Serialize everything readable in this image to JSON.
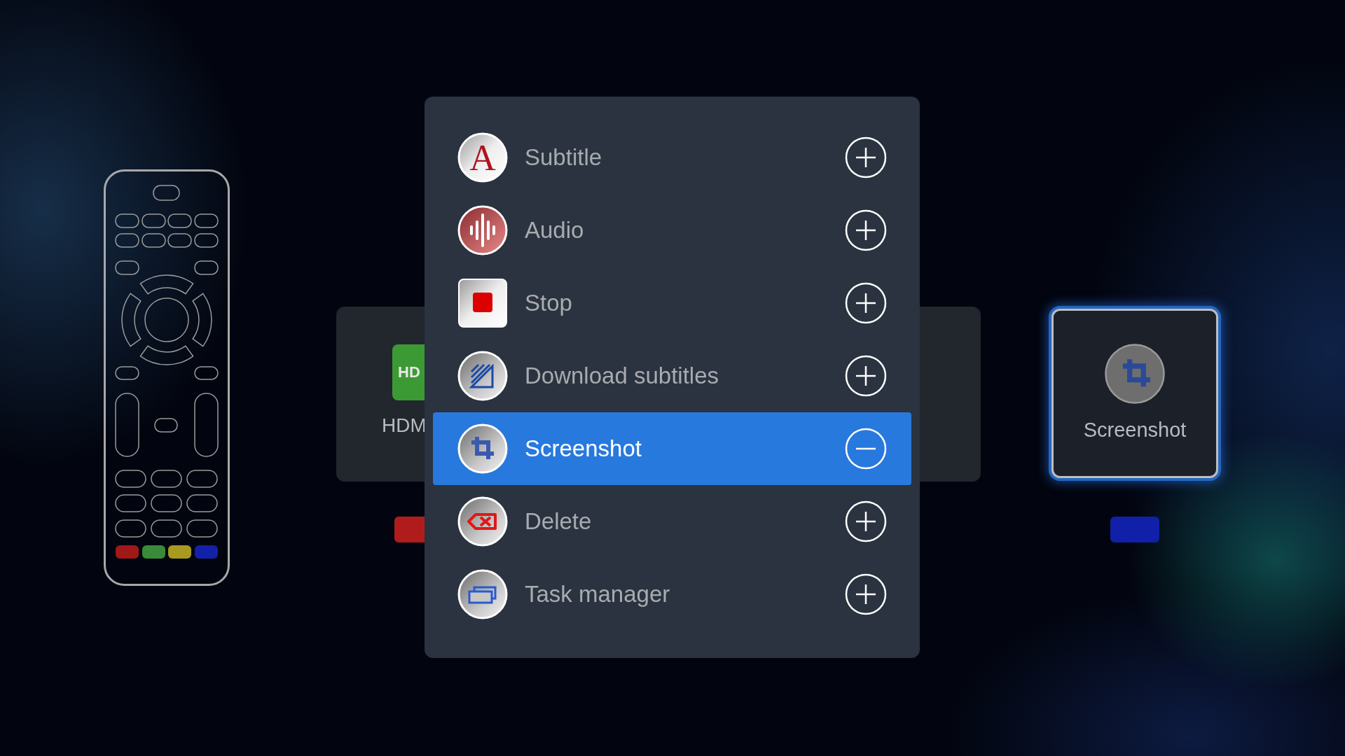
{
  "remote": {
    "color_keys": [
      {
        "color": "#a01818"
      },
      {
        "color": "#3a8a3a"
      },
      {
        "color": "#a89a20"
      },
      {
        "color": "#1222a8"
      }
    ]
  },
  "backdrop_tile": {
    "badge": "HD",
    "label": "HDM"
  },
  "selected_card": {
    "label": "Screenshot",
    "selected": true
  },
  "hint_keys": [
    {
      "color": "#b01c1c"
    },
    {
      "color": "#1020a8"
    }
  ],
  "menu": {
    "items": [
      {
        "label": "Subtitle",
        "kind": "subtitle",
        "glyph": "A",
        "added": false,
        "selected": false
      },
      {
        "label": "Audio",
        "kind": "audio",
        "added": false,
        "selected": false
      },
      {
        "label": "Stop",
        "kind": "stop",
        "added": false,
        "selected": false
      },
      {
        "label": "Download subtitles",
        "kind": "download",
        "added": false,
        "selected": false
      },
      {
        "label": "Screenshot",
        "kind": "screenshot",
        "added": true,
        "selected": true
      },
      {
        "label": "Delete",
        "kind": "delete",
        "added": false,
        "selected": false
      },
      {
        "label": "Task manager",
        "kind": "tasks",
        "added": false,
        "selected": false
      }
    ]
  }
}
